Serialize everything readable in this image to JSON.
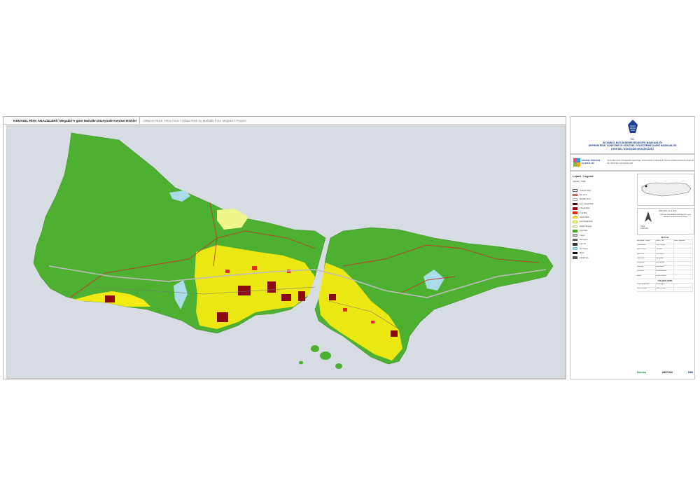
{
  "title": {
    "main": "KENTSEL RİSK ANALİZLERİ / MegaİST'e göre Mahalle Düzeyinde Kentsel Riskler",
    "subtitle": "URBAN RISK ANALYSIS / Urban Risk by Mahalle from MegaIST Project"
  },
  "institution": {
    "tc": "T.C.",
    "line1": "İSTANBUL BÜYÜKŞEHİR BELEDİYE BAŞKANLIĞI",
    "line2": "DEPREM RİSK YÖNETİMİ VE KENTSEL İYİLEŞTİRME DAİRE BAŞKANLIĞI",
    "line3": "KENTSEL DÖNÜŞÜM MÜDÜRLÜĞÜ",
    "project_logo": "KENTSEL DÖNÜŞÜM EYLEM PLANI",
    "project_text": "İSTANBUL BÜYÜKŞEHİR KENTSEL DÖNÜŞÜM STRATEJİ PLANI HAZIRLANMASI ANALİZ VE SENTEZ ÇALIŞMALARI"
  },
  "legend": {
    "title": "Lejant - Legend",
    "subtitle": "ANALİZ_TÜRÜ",
    "items": [
      {
        "label": "Yerleşim Alanı",
        "color": "#ffffff",
        "border": "#555555"
      },
      {
        "label": "İlçe Sınırı",
        "color": "#ffffff",
        "border": "#c0392b"
      },
      {
        "label": "Mahalle Sınırı",
        "color": "#ffffff",
        "border": "#b0b0b0"
      },
      {
        "label": "Çok Yüksek Risk",
        "color": "#4a0d12",
        "border": "#4a0d12"
      },
      {
        "label": "Yüksek Risk",
        "color": "#8b0a14",
        "border": "#8b0a14"
      },
      {
        "label": "Orta Risk",
        "color": "#e03010",
        "border": "#e03010"
      },
      {
        "label": "Düşük Risk",
        "color": "#f2ea12",
        "border": "#c9c10e"
      },
      {
        "label": "Çok Düşük Risk",
        "color": "#eef68a",
        "border": "#c8d05a"
      },
      {
        "label": "Riskli Olmayan",
        "color": "#ecf6d4",
        "border": "#b9c79a"
      },
      {
        "label": "Yeşil Alan",
        "color": "#4db030",
        "border": "#3d8f26"
      },
      {
        "label": "Otoyol",
        "color": "#bdbdbd",
        "border": "#8a8a8a"
      },
      {
        "label": "Demiryolu",
        "color": "#777777",
        "border": "#555555"
      },
      {
        "label": "Ana Yol",
        "color": "#333333",
        "border": "#333333"
      },
      {
        "label": "Su Yüzeyi",
        "color": "#a9dbe8",
        "border": "#7fbfd3"
      },
      {
        "label": "Metro",
        "color": "#111111",
        "border": "#111111"
      },
      {
        "label": "Havalimanı",
        "color": "#555555",
        "border": "#555555"
      }
    ]
  },
  "info": {
    "date": "Pafta Tarihi: 01.11.2019",
    "sheet_title": "KENTSEL RİSK ANALİZLERİ MegaİST'e göre Mahalle Düzeyinde Kentsel Riskler",
    "scale_label": "Ölçek",
    "scale": "1/100.000"
  },
  "table": {
    "header": "İMZALAR",
    "columns": [
      "Adı Soyadı / Ünvanı",
      "Görevi / Title",
      "İmza / Signature"
    ],
    "rows": [
      [
        "Proje Müdürü",
        "Proje Yönetimi",
        ""
      ],
      [
        "Şehir Plancısı",
        "Planlama",
        ""
      ],
      [
        "Harita Müh.",
        "CBS Uzmanı",
        ""
      ],
      [
        "İnşaat Müh.",
        "Yapı Analizi",
        ""
      ],
      [
        "Jeoloji Müh.",
        "Zemin Analizi",
        ""
      ],
      [
        "Sosyolog",
        "Sosyal Analiz",
        ""
      ],
      [
        "Ekonomist",
        "Ekonomik Analiz",
        ""
      ],
      [
        "Mimar",
        "Kentsel Tasarım",
        ""
      ]
    ],
    "header2": "YÜKLENİCİ FİRMA",
    "rows2": [
      [
        "Proje Koordinatörü",
        "Koordinasyon",
        ""
      ],
      [
        "Teknik Sorumlu",
        "Teknik Yönetim",
        ""
      ]
    ]
  },
  "logos": [
    "Bimtaş",
    "AECOM",
    "İBB"
  ]
}
